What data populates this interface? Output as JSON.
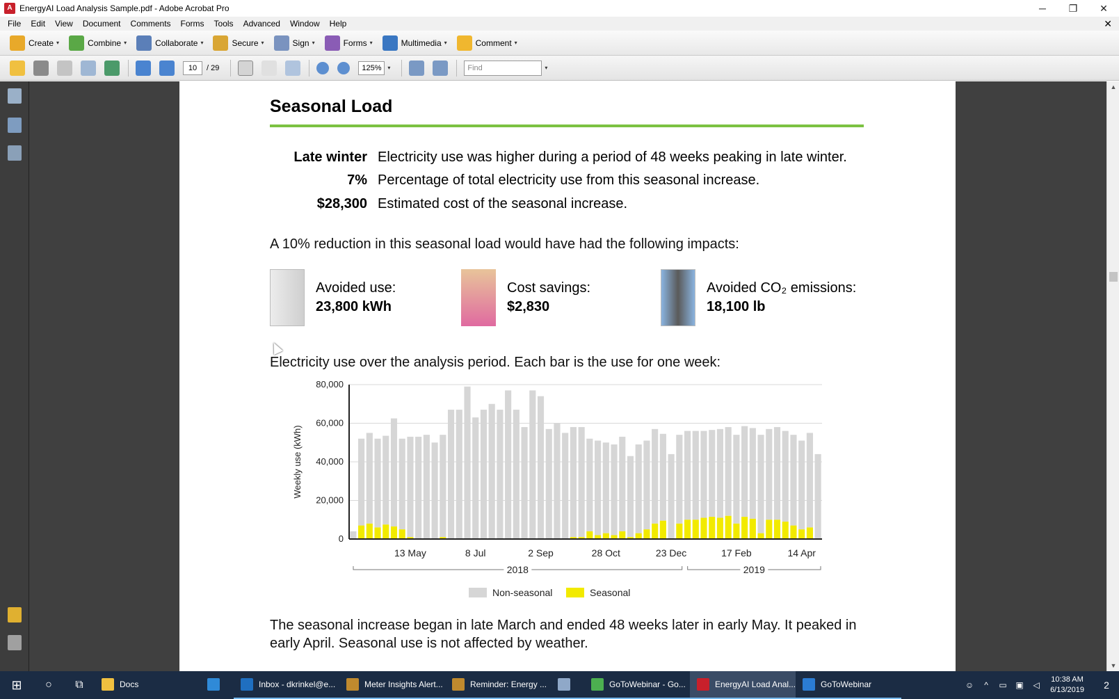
{
  "window": {
    "title": "EnergyAI Load Analysis Sample.pdf - Adobe Acrobat Pro",
    "minimize": "─",
    "restore": "❐",
    "close": "✕"
  },
  "menu": {
    "items": [
      "File",
      "Edit",
      "View",
      "Document",
      "Comments",
      "Forms",
      "Tools",
      "Advanced",
      "Window",
      "Help"
    ],
    "doc_close": "✕"
  },
  "toolbar": {
    "create": "Create",
    "combine": "Combine",
    "collaborate": "Collaborate",
    "secure": "Secure",
    "sign": "Sign",
    "forms": "Forms",
    "multimedia": "Multimedia",
    "comment": "Comment",
    "caret": "▾"
  },
  "nav": {
    "page_current": "10",
    "page_total": "/ 29",
    "zoom": "125%",
    "find_placeholder": "Find"
  },
  "colors": {
    "accent_rule": "#7cc242",
    "non_seasonal": "#d6d6d6",
    "seasonal": "#f2ea00",
    "taskbar": "#1b2c44"
  },
  "page": {
    "title": "Seasonal Load",
    "facts": [
      {
        "key": "Late winter",
        "value": "Electricity use was higher during a period of 48 weeks peaking in late winter."
      },
      {
        "key": "7%",
        "value": "Percentage of total electricity use from this seasonal increase."
      },
      {
        "key": "$28,300",
        "value": "Estimated cost of the seasonal increase."
      }
    ],
    "reduction_intro": "A 10% reduction in this seasonal load would have had the following impacts:",
    "impacts": [
      {
        "label": "Avoided use:",
        "amount": "23,800 kWh",
        "icon": "light-switch"
      },
      {
        "label": "Cost savings:",
        "amount": "$2,830",
        "icon": "piggy-bank"
      },
      {
        "label": "Avoided CO₂ emissions:",
        "amount": "18,100 lb",
        "icon": "smokestack"
      }
    ],
    "chart_caption": "Electricity use over the analysis period. Each bar is the use for one week:",
    "footer_line1": "The seasonal increase began in late March and ended 48 weeks later in early May. It peaked in",
    "footer_line2": "early April. Seasonal use is not affected by weather."
  },
  "chart_data": {
    "type": "bar",
    "stacked": true,
    "ylabel": "Weekly use (kWh)",
    "ylim": [
      0,
      80000
    ],
    "yticks": [
      0,
      20000,
      40000,
      60000,
      80000
    ],
    "ytick_labels": [
      "0",
      "20,000",
      "40,000",
      "60,000",
      "80,000"
    ],
    "xtick_labels": [
      {
        "label": "13 May",
        "index": 7
      },
      {
        "label": "8 Jul",
        "index": 15
      },
      {
        "label": "2 Sep",
        "index": 23
      },
      {
        "label": "28 Oct",
        "index": 31
      },
      {
        "label": "23 Dec",
        "index": 39
      },
      {
        "label": "17 Feb",
        "index": 47
      },
      {
        "label": "14 Apr",
        "index": 55
      }
    ],
    "year_labels": [
      {
        "label": "2018",
        "start": 0,
        "end": 40
      },
      {
        "label": "2019",
        "start": 41,
        "end": 57
      }
    ],
    "legend": [
      "Non-seasonal",
      "Seasonal"
    ],
    "legend_position": "bottom",
    "grid": true,
    "series": [
      {
        "name": "Non-seasonal",
        "values": [
          4000,
          45000,
          47000,
          46000,
          46000,
          56000,
          47000,
          52000,
          53000,
          54000,
          50000,
          53000,
          67000,
          67000,
          79000,
          63000,
          67000,
          70000,
          67000,
          77000,
          67000,
          58000,
          77000,
          74000,
          57000,
          60000,
          55000,
          57000,
          57000,
          48000,
          49000,
          47000,
          47000,
          49000,
          42000,
          46000,
          46000,
          49000,
          45000,
          44000,
          46000,
          46000,
          46000,
          45000,
          45000,
          46000,
          46000,
          46000,
          47000,
          47000,
          51000,
          47000,
          48000,
          47000,
          47000,
          46000,
          49000,
          44000
        ]
      },
      {
        "name": "Seasonal",
        "values": [
          0,
          7000,
          8000,
          6000,
          7500,
          6500,
          5000,
          1000,
          0,
          0,
          0,
          1000,
          0,
          0,
          0,
          0,
          0,
          0,
          0,
          0,
          0,
          0,
          0,
          0,
          0,
          0,
          0,
          1000,
          1000,
          4000,
          2000,
          3000,
          2000,
          4000,
          1000,
          3000,
          5000,
          8000,
          9500,
          0,
          8000,
          10000,
          10000,
          11000,
          11500,
          11000,
          12000,
          8000,
          11500,
          10500,
          3000,
          10000,
          10000,
          9000,
          7000,
          5000,
          6000,
          0
        ]
      }
    ]
  },
  "taskbar": {
    "start": "⊞",
    "search": "○",
    "taskview": "⧉",
    "apps": [
      {
        "label": "Docs",
        "color": "#f0c040",
        "active": false,
        "underline": false
      },
      {
        "label": "",
        "color": "#2f8ad8",
        "active": false,
        "underline": false,
        "icon_only": true
      },
      {
        "label": "Inbox - dkrinkel@e...",
        "color": "#1f6fc0",
        "active": false,
        "underline": true
      },
      {
        "label": "Meter Insights Alert...",
        "color": "#c08a2e",
        "active": false,
        "underline": true
      },
      {
        "label": "Reminder: Energy ...",
        "color": "#c08a2e",
        "active": false,
        "underline": true
      },
      {
        "label": "",
        "color": "#8fa8c8",
        "active": false,
        "underline": true,
        "icon_only": true
      },
      {
        "label": "GoToWebinar - Go...",
        "color": "#4caf50",
        "active": false,
        "underline": true
      },
      {
        "label": "EnergyAI Load Anal...",
        "color": "#c8202b",
        "active": true,
        "underline": true
      },
      {
        "label": "GoToWebinar",
        "color": "#2b7cd3",
        "active": false,
        "underline": true
      }
    ],
    "time": "10:38 AM",
    "date": "6/13/2019",
    "notif_count": "2"
  }
}
